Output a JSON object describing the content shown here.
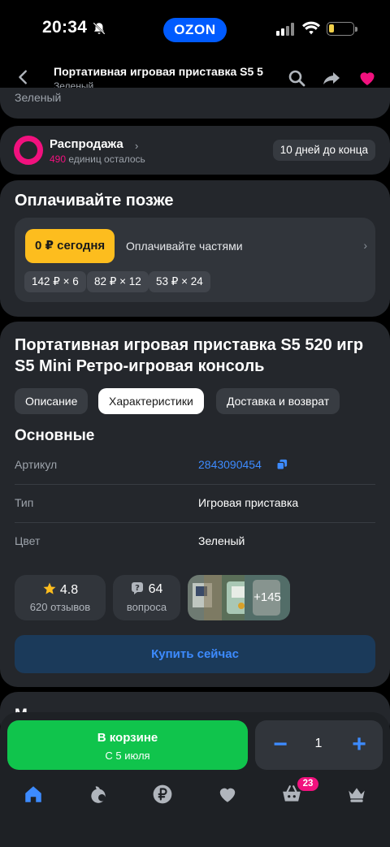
{
  "status_bar": {
    "time": "20:34",
    "brand": "OZON"
  },
  "header": {
    "title": "Портативная игровая приставка S5 5",
    "subtitle": "Зеленый"
  },
  "top_card": {
    "peek_text": "Зеленый"
  },
  "sale": {
    "title": "Распродажа",
    "remaining_count": "490",
    "remaining_text": "единиц осталось",
    "days_left": "10 дней до конца"
  },
  "pay_later": {
    "title": "Оплачивайте позже",
    "today_label": "0 ₽ сегодня",
    "parts_label": "Оплачивайте частями",
    "chips": [
      "142 ₽ × 6",
      "82 ₽ × 12",
      "53 ₽ × 24"
    ]
  },
  "product": {
    "title": "Портативная игровая приставка S5 520 игр S5 Mini Ретро-игровая консоль",
    "tabs": [
      "Описание",
      "Характеристики",
      "Доставка и возврат"
    ],
    "active_tab": "Характеристики",
    "section_title": "Основные",
    "specs": [
      {
        "key": "Артикул",
        "value": "2843090454"
      },
      {
        "key": "Тип",
        "value": "Игровая приставка"
      },
      {
        "key": "Цвет",
        "value": "Зеленый"
      }
    ],
    "rating": "4.8",
    "reviews": "620 отзывов",
    "questions_count": "64",
    "questions_label": "вопроса",
    "photos_more": "+145",
    "buy_now": "Купить сейчас"
  },
  "next_section": {
    "peek_text": "М"
  },
  "cart": {
    "label": "В корзине",
    "delivery": "С 5 июля",
    "quantity": "1"
  },
  "bottom_nav": {
    "items": [
      "home-icon",
      "fresh-icon",
      "ruble-icon",
      "favorites-icon",
      "cart-icon",
      "profile-icon"
    ],
    "cart_badge": "23"
  },
  "colors": {
    "background": "#000000",
    "card": "#24272c",
    "accent_blue": "#3d8bff",
    "brand_blue": "#005bff",
    "sale_pink": "#f1117e",
    "pay_yellow": "#fdbd1e",
    "cart_green": "#10c44c"
  }
}
